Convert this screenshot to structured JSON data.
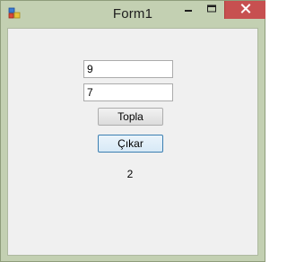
{
  "window": {
    "title": "Form1",
    "icons": {
      "app": "form-app-icon",
      "minimize": "minimize-icon",
      "maximize": "maximize-icon",
      "close": "close-icon"
    },
    "close_color": "#c75050"
  },
  "form": {
    "input1_value": "9",
    "input2_value": "7",
    "add_label": "Topla",
    "subtract_label": "Çıkar",
    "result_text": "2"
  }
}
